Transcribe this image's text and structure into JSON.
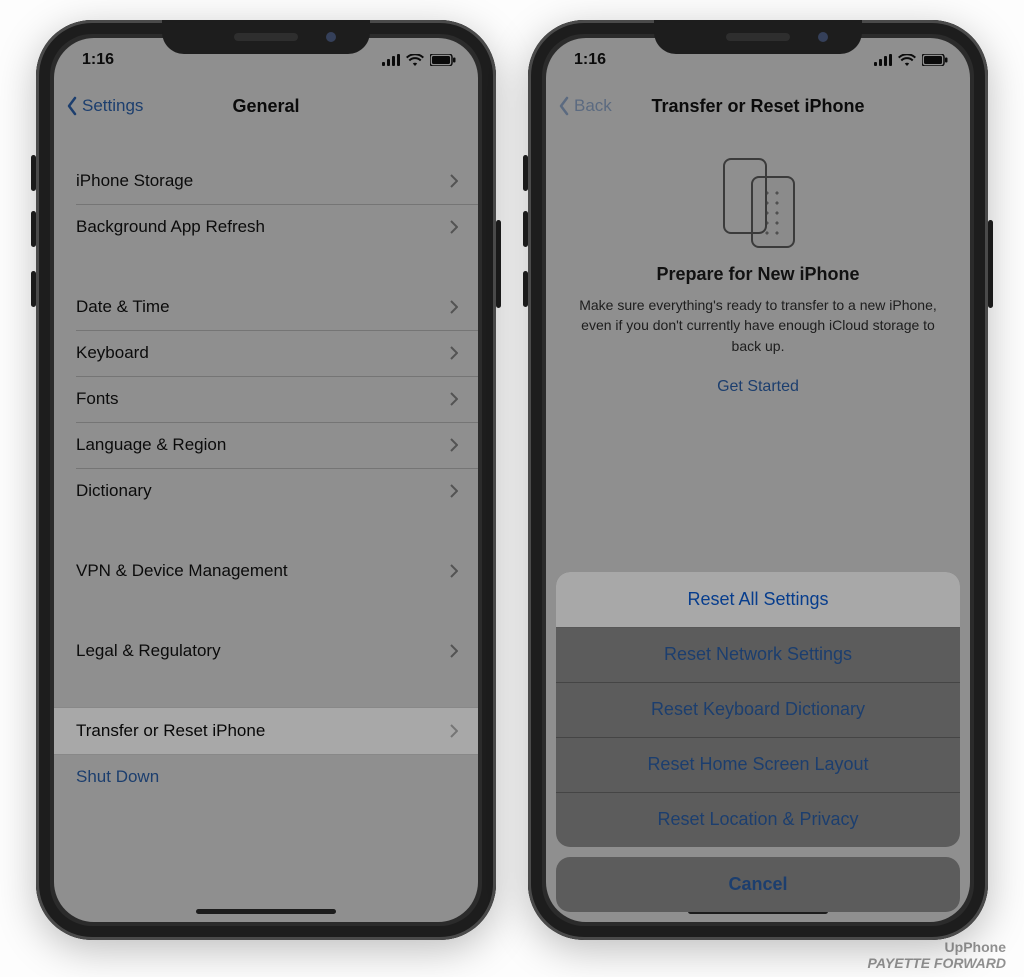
{
  "status": {
    "time": "1:16"
  },
  "left": {
    "back_label": "Settings",
    "title": "General",
    "groups": [
      {
        "rows": [
          {
            "label": "iPhone Storage"
          },
          {
            "label": "Background App Refresh"
          }
        ]
      },
      {
        "rows": [
          {
            "label": "Date & Time"
          },
          {
            "label": "Keyboard"
          },
          {
            "label": "Fonts"
          },
          {
            "label": "Language & Region"
          },
          {
            "label": "Dictionary"
          }
        ]
      },
      {
        "rows": [
          {
            "label": "VPN & Device Management"
          }
        ]
      },
      {
        "rows": [
          {
            "label": "Legal & Regulatory"
          }
        ]
      },
      {
        "rows": [
          {
            "label": "Transfer or Reset iPhone",
            "highlight": true
          },
          {
            "label": "Shut Down",
            "link": true
          }
        ]
      }
    ]
  },
  "right": {
    "back_label": "Back",
    "title": "Transfer or Reset iPhone",
    "prepare": {
      "heading": "Prepare for New iPhone",
      "body": "Make sure everything's ready to transfer to a new iPhone, even if you don't currently have enough iCloud storage to back up.",
      "cta": "Get Started"
    },
    "sheet": {
      "options": [
        "Reset All Settings",
        "Reset Network Settings",
        "Reset Keyboard Dictionary",
        "Reset Home Screen Layout",
        "Reset Location & Privacy"
      ],
      "highlight_index": 0,
      "cancel": "Cancel"
    }
  },
  "watermark": {
    "line1": "UpPhone",
    "line2": "PAYETTE FORWARD"
  }
}
